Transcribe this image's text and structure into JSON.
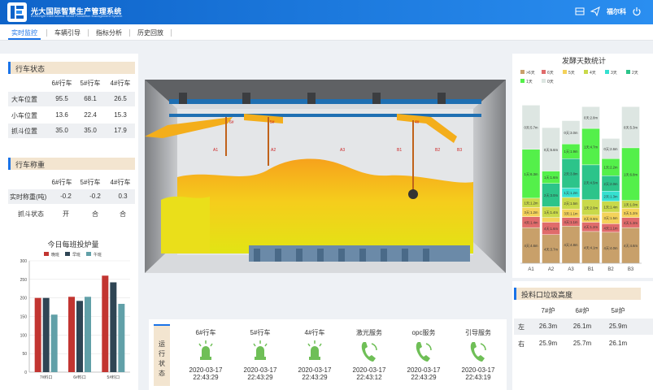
{
  "topbar": {
    "brand": "光大国际智慧生产管理系统",
    "brand_sub": "Everbright International Smart Production Management System",
    "user": "福尔科",
    "icons": [
      "grid-icon",
      "send-icon",
      "power-icon"
    ]
  },
  "nav": {
    "tabs": [
      "实时监控",
      "车辆引导",
      "指标分析",
      "历史回放"
    ],
    "active": 0
  },
  "crane_status": {
    "title": "行车状态",
    "columns": [
      "6#行车",
      "5#行车",
      "4#行车"
    ],
    "rows": [
      {
        "label": "大车位置",
        "values": [
          "95.5",
          "68.1",
          "26.5"
        ]
      },
      {
        "label": "小车位置",
        "values": [
          "13.6",
          "22.4",
          "15.3"
        ]
      },
      {
        "label": "抓斗位置",
        "values": [
          "35.0",
          "35.0",
          "17.9"
        ]
      }
    ]
  },
  "crane_weigh": {
    "title": "行车称重",
    "columns": [
      "6#行车",
      "5#行车",
      "4#行车"
    ],
    "rows": [
      {
        "label": "实时称重(吨)",
        "values": [
          "-0.2",
          "-0.2",
          "0.3"
        ]
      },
      {
        "label": "抓斗状态",
        "values": [
          "开",
          "合",
          "合"
        ]
      }
    ]
  },
  "feed_chart": {
    "title": "今日每班投炉量",
    "chart_data": {
      "type": "bar",
      "categories": [
        "7#料口",
        "6#料口",
        "5#料口"
      ],
      "series": [
        {
          "name": "晚班",
          "values": [
            200,
            203,
            260
          ],
          "color": "#c23531"
        },
        {
          "name": "早班",
          "values": [
            200,
            192,
            242
          ],
          "color": "#2f4554"
        },
        {
          "name": "午班",
          "values": [
            155,
            203,
            184
          ],
          "color": "#61a0a8"
        }
      ],
      "ylim": [
        0,
        300
      ],
      "yticks": [
        "0",
        "50",
        "100",
        "150",
        "200",
        "250",
        "300"
      ],
      "grid": true,
      "legend": "top"
    }
  },
  "ferment_chart": {
    "title": "发酵天数统计",
    "chart_data": {
      "type": "bar",
      "stacked": true,
      "categories": [
        "A1",
        "A2",
        "A3",
        "B1",
        "B2",
        "B3"
      ],
      "legend": [
        {
          "name": ">6天",
          "color": "#c8a06a"
        },
        {
          "name": "6天",
          "color": "#e06b6b"
        },
        {
          "name": "5天",
          "color": "#f4d25a"
        },
        {
          "name": "4天",
          "color": "#c9d94a"
        },
        {
          "name": "3天",
          "color": "#35e0d0"
        },
        {
          "name": "2天",
          "color": "#2cc48a"
        },
        {
          "name": "1天",
          "color": "#54f04a"
        },
        {
          "name": "0天",
          "color": "#dde6e2"
        }
      ],
      "series": [
        {
          "name": ">6天",
          "values": [
            4.6,
            3.7,
            4.8,
            4.1,
            4.0,
            4.6
          ],
          "labels": [
            "4天:4.6m",
            "4天:3.7m",
            "4天:4.8m",
            "4天:4.1m",
            "4天:4.0m",
            "4天:4.6m"
          ]
        },
        {
          "name": "6天",
          "values": [
            1.4,
            1.6,
            1.1,
            1.2,
            1.1,
            1.3
          ],
          "labels": [
            "4天:1.4m",
            "4天:1.6m",
            "4天:1.1m",
            "4天:1.2m",
            "4天:1.1m",
            "4天:1.3m"
          ]
        },
        {
          "name": "5天",
          "values": [
            1.2,
            0.6,
            1.1,
            0.9,
            1.5,
            1.2
          ],
          "labels": [
            "3天:1.2m",
            "",
            "3天:1.1m",
            "3天:0.9m",
            "3天:1.5m",
            "3天:1.2m"
          ]
        },
        {
          "name": "4天",
          "values": [
            1.2,
            1.4,
            1.5,
            2.0,
            1.4,
            1.0
          ],
          "labels": [
            "1天:1.2m",
            "1天:1.4m",
            "2天:1.5m",
            "1天:2.0m",
            "1天:1.4m",
            "1天:1.0m"
          ]
        },
        {
          "name": "3天",
          "values": [
            0,
            0,
            1.2,
            0,
            1.3,
            0
          ],
          "labels": [
            "",
            "",
            "1天:1.2m",
            "",
            "2天:1.3m",
            ""
          ]
        },
        {
          "name": "2天",
          "values": [
            0,
            3.0,
            3.8,
            4.5,
            2.0,
            0
          ],
          "labels": [
            "",
            "2天:3.0m",
            "2天:3.8m",
            "2天:4.5m",
            "2天:2.0m",
            ""
          ]
        },
        {
          "name": "1天",
          "values": [
            6.3,
            1.6,
            1.9,
            4.7,
            2.2,
            6.8
          ],
          "labels": [
            "1天:6.3m",
            "1天:1.6m",
            "1天:1.9m",
            "1天:4.7m",
            "1天:2.2m",
            "1天:6.8m"
          ]
        },
        {
          "name": "0天",
          "values": [
            5.7,
            5.6,
            3.0,
            2.8,
            2.6,
            5.3
          ],
          "labels": [
            "0天:5.7m",
            "0天:5.6m",
            "0天:3.0m",
            "0天:2.8m",
            "0天:2.6m",
            "0天:5.3m"
          ]
        }
      ],
      "ylim": [
        0,
        21.6
      ]
    }
  },
  "waste_height": {
    "title": "投料口垃圾高度",
    "columns": [
      "7#炉",
      "6#炉",
      "5#炉"
    ],
    "rows": [
      {
        "label": "左",
        "values": [
          "26.3m",
          "26.1m",
          "25.9m"
        ]
      },
      {
        "label": "右",
        "values": [
          "25.9m",
          "25.7m",
          "26.1m"
        ]
      }
    ]
  },
  "run_status": {
    "label": [
      "运",
      "行",
      "状",
      "态"
    ],
    "services": [
      {
        "name": "6#行车",
        "date": "2020-03-17",
        "time": "22:43:29",
        "icon": "crane-bell-icon"
      },
      {
        "name": "5#行车",
        "date": "2020-03-17",
        "time": "22:43:29",
        "icon": "crane-bell-icon"
      },
      {
        "name": "4#行车",
        "date": "2020-03-17",
        "time": "22:43:29",
        "icon": "crane-bell-icon"
      },
      {
        "name": "激光服务",
        "date": "2020-03-17",
        "time": "22:43:12",
        "icon": "phone-icon"
      },
      {
        "name": "opc服务",
        "date": "2020-03-17",
        "time": "22:43:29",
        "icon": "phone-icon"
      },
      {
        "name": "引导服务",
        "date": "2020-03-17",
        "time": "22:43:19",
        "icon": "phone-icon"
      }
    ]
  },
  "scene": {
    "crane_tags": [
      "6#",
      "5#",
      "4#"
    ],
    "bay_tags": [
      "A1",
      "A2",
      "A3",
      "B1",
      "B2",
      "B3"
    ]
  }
}
